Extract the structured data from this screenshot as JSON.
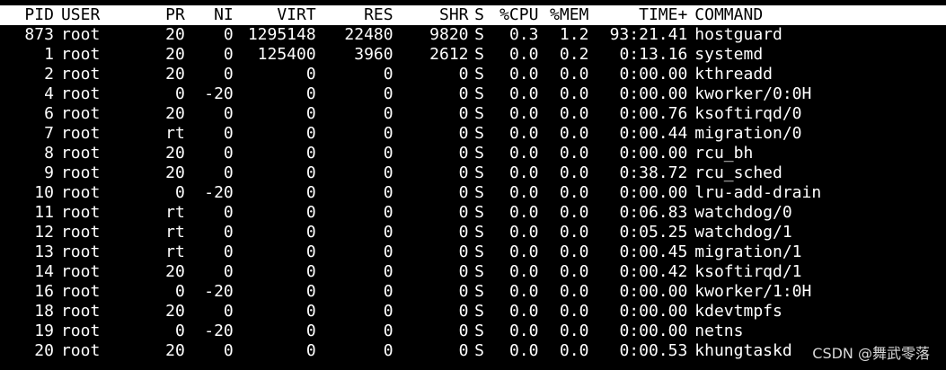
{
  "header": {
    "pid": "PID",
    "user": "USER",
    "pr": "PR",
    "ni": "NI",
    "virt": "VIRT",
    "res": "RES",
    "shr": "SHR",
    "s": "S",
    "cpu": "%CPU",
    "mem": "%MEM",
    "time": "TIME+",
    "command": "COMMAND"
  },
  "processes": [
    {
      "pid": "873",
      "user": "root",
      "pr": "20",
      "ni": "0",
      "virt": "1295148",
      "res": "22480",
      "shr": "9820",
      "s": "S",
      "cpu": "0.3",
      "mem": "1.2",
      "time": "93:21.41",
      "command": "hostguard"
    },
    {
      "pid": "1",
      "user": "root",
      "pr": "20",
      "ni": "0",
      "virt": "125400",
      "res": "3960",
      "shr": "2612",
      "s": "S",
      "cpu": "0.0",
      "mem": "0.2",
      "time": "0:13.16",
      "command": "systemd"
    },
    {
      "pid": "2",
      "user": "root",
      "pr": "20",
      "ni": "0",
      "virt": "0",
      "res": "0",
      "shr": "0",
      "s": "S",
      "cpu": "0.0",
      "mem": "0.0",
      "time": "0:00.00",
      "command": "kthreadd"
    },
    {
      "pid": "4",
      "user": "root",
      "pr": "0",
      "ni": "-20",
      "virt": "0",
      "res": "0",
      "shr": "0",
      "s": "S",
      "cpu": "0.0",
      "mem": "0.0",
      "time": "0:00.00",
      "command": "kworker/0:0H"
    },
    {
      "pid": "6",
      "user": "root",
      "pr": "20",
      "ni": "0",
      "virt": "0",
      "res": "0",
      "shr": "0",
      "s": "S",
      "cpu": "0.0",
      "mem": "0.0",
      "time": "0:00.76",
      "command": "ksoftirqd/0"
    },
    {
      "pid": "7",
      "user": "root",
      "pr": "rt",
      "ni": "0",
      "virt": "0",
      "res": "0",
      "shr": "0",
      "s": "S",
      "cpu": "0.0",
      "mem": "0.0",
      "time": "0:00.44",
      "command": "migration/0"
    },
    {
      "pid": "8",
      "user": "root",
      "pr": "20",
      "ni": "0",
      "virt": "0",
      "res": "0",
      "shr": "0",
      "s": "S",
      "cpu": "0.0",
      "mem": "0.0",
      "time": "0:00.00",
      "command": "rcu_bh"
    },
    {
      "pid": "9",
      "user": "root",
      "pr": "20",
      "ni": "0",
      "virt": "0",
      "res": "0",
      "shr": "0",
      "s": "S",
      "cpu": "0.0",
      "mem": "0.0",
      "time": "0:38.72",
      "command": "rcu_sched"
    },
    {
      "pid": "10",
      "user": "root",
      "pr": "0",
      "ni": "-20",
      "virt": "0",
      "res": "0",
      "shr": "0",
      "s": "S",
      "cpu": "0.0",
      "mem": "0.0",
      "time": "0:00.00",
      "command": "lru-add-drain"
    },
    {
      "pid": "11",
      "user": "root",
      "pr": "rt",
      "ni": "0",
      "virt": "0",
      "res": "0",
      "shr": "0",
      "s": "S",
      "cpu": "0.0",
      "mem": "0.0",
      "time": "0:06.83",
      "command": "watchdog/0"
    },
    {
      "pid": "12",
      "user": "root",
      "pr": "rt",
      "ni": "0",
      "virt": "0",
      "res": "0",
      "shr": "0",
      "s": "S",
      "cpu": "0.0",
      "mem": "0.0",
      "time": "0:05.25",
      "command": "watchdog/1"
    },
    {
      "pid": "13",
      "user": "root",
      "pr": "rt",
      "ni": "0",
      "virt": "0",
      "res": "0",
      "shr": "0",
      "s": "S",
      "cpu": "0.0",
      "mem": "0.0",
      "time": "0:00.45",
      "command": "migration/1"
    },
    {
      "pid": "14",
      "user": "root",
      "pr": "20",
      "ni": "0",
      "virt": "0",
      "res": "0",
      "shr": "0",
      "s": "S",
      "cpu": "0.0",
      "mem": "0.0",
      "time": "0:00.42",
      "command": "ksoftirqd/1"
    },
    {
      "pid": "16",
      "user": "root",
      "pr": "0",
      "ni": "-20",
      "virt": "0",
      "res": "0",
      "shr": "0",
      "s": "S",
      "cpu": "0.0",
      "mem": "0.0",
      "time": "0:00.00",
      "command": "kworker/1:0H"
    },
    {
      "pid": "18",
      "user": "root",
      "pr": "20",
      "ni": "0",
      "virt": "0",
      "res": "0",
      "shr": "0",
      "s": "S",
      "cpu": "0.0",
      "mem": "0.0",
      "time": "0:00.00",
      "command": "kdevtmpfs"
    },
    {
      "pid": "19",
      "user": "root",
      "pr": "0",
      "ni": "-20",
      "virt": "0",
      "res": "0",
      "shr": "0",
      "s": "S",
      "cpu": "0.0",
      "mem": "0.0",
      "time": "0:00.00",
      "command": "netns"
    },
    {
      "pid": "20",
      "user": "root",
      "pr": "20",
      "ni": "0",
      "virt": "0",
      "res": "0",
      "shr": "0",
      "s": "S",
      "cpu": "0.0",
      "mem": "0.0",
      "time": "0:00.53",
      "command": "khungtaskd"
    }
  ],
  "watermark": "CSDN @舞武零落",
  "colors": {
    "background": "#000000",
    "foreground": "#ffffff",
    "header_bg": "#ffffff",
    "header_fg": "#000000"
  }
}
